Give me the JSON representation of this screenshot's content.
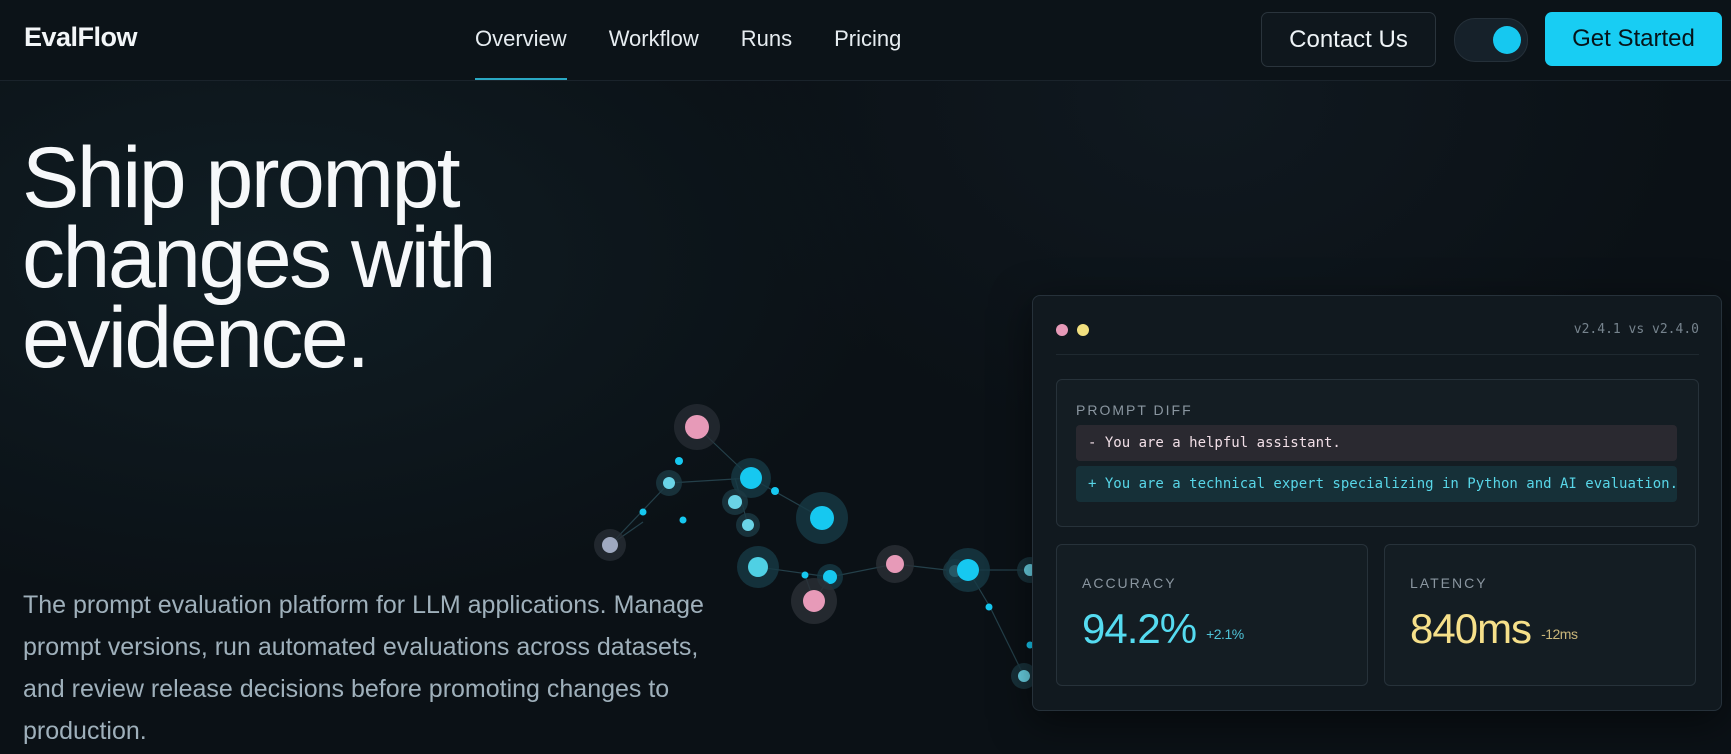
{
  "header": {
    "brand": "EvalFlow",
    "nav": [
      {
        "label": "Overview",
        "active": true
      },
      {
        "label": "Workflow",
        "active": false
      },
      {
        "label": "Runs",
        "active": false
      },
      {
        "label": "Pricing",
        "active": false
      }
    ],
    "contact_label": "Contact Us",
    "cta_label": "Get Started",
    "theme_toggle_on": true
  },
  "hero": {
    "title": "Ship prompt changes with evidence.",
    "subtitle": "The prompt evaluation platform for LLM applications. Manage prompt versions, run automated evaluations across datasets, and review release decisions before promoting changes to production."
  },
  "card": {
    "version": "v2.4.1 vs v2.4.0",
    "diff_label": "PROMPT DIFF",
    "diff_removed": "- You are a helpful assistant.",
    "diff_added": "+ You are a technical expert specializing in Python and AI evaluation.",
    "metrics": [
      {
        "label": "ACCURACY",
        "value": "94.2%",
        "delta": "+2.1%"
      },
      {
        "label": "LATENCY",
        "value": "840ms",
        "delta": "-12ms"
      }
    ]
  },
  "colors": {
    "accent": "#18cdf3",
    "pink": "#e79ab8",
    "yellow": "#f2e07f",
    "background": "#0b1116"
  }
}
